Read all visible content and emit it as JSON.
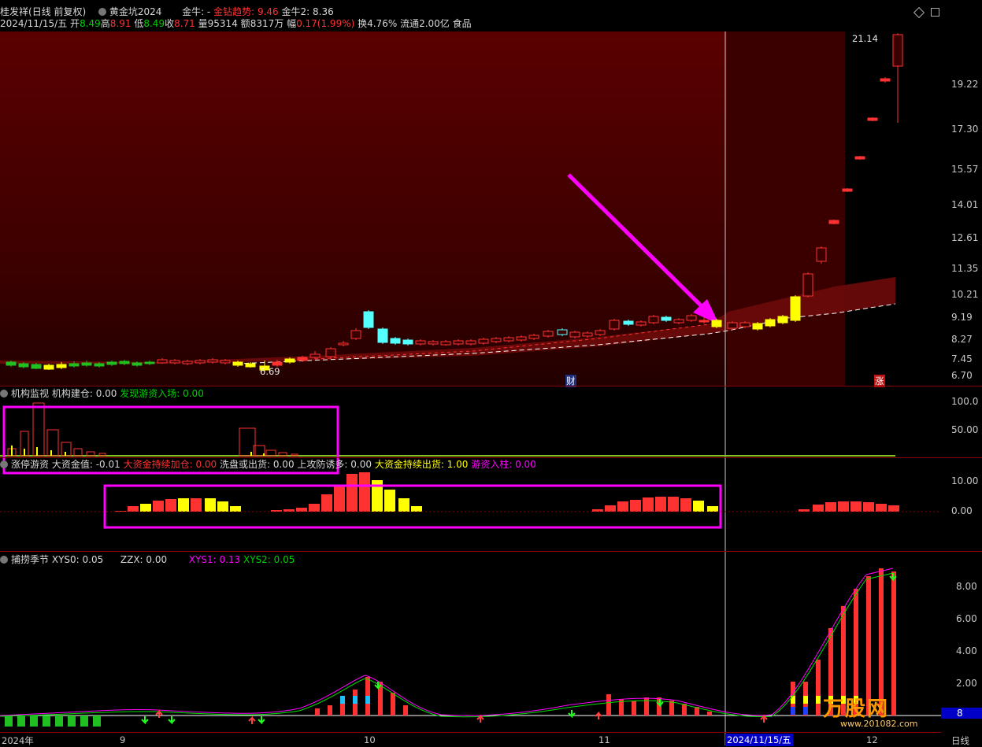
{
  "topbar": {
    "stock_name": "桂发祥",
    "period": "(日线 前复权)",
    "formula": "黄金坑2024",
    "jinniu_label": "金牛: -",
    "jinzuan_label": "金钻趋势: 9.46",
    "jinniu2_label": "金牛2: 8.36"
  },
  "quote": {
    "date": "2024/11/15/五",
    "open_label": "开",
    "open": "8.49",
    "high_label": "高",
    "high": "8.91",
    "low_label": "低",
    "low": "8.49",
    "close_label": "收",
    "close": "8.71",
    "vol_label": "量",
    "vol": "95314",
    "amt_label": "额",
    "amt": "8317万",
    "chg_label": "幅",
    "chg": "0.17(1.99%)",
    "turn": "换4.76%",
    "float": "流通2.00亿",
    "industry": "食品"
  },
  "main_axis": [
    "21.14",
    "19.22",
    "17.30",
    "15.57",
    "14.01",
    "12.61",
    "11.35",
    "10.21",
    "9.19",
    "8.27",
    "7.45",
    "6.70"
  ],
  "main_marks": {
    "high_tag": "21.14",
    "low_tag": "6.69",
    "cai": "财",
    "zhang": "涨"
  },
  "panel1": {
    "title": "机构监视",
    "l1": "机构建仓: 0.00",
    "l2": "发现游资入场: 0.00",
    "axis": [
      "100.0",
      "50.00"
    ]
  },
  "panel2": {
    "title": "涨停游资",
    "l1": "大资金值: -0.01",
    "l2": "大资金持续加仓: 0.00",
    "l3": "洗盘或出货: 0.00",
    "l4": "上攻防诱多: 0.00",
    "l5": "大资金持续出货: 1.00",
    "l6": "游资入柱: 0.00",
    "axis": [
      "10.00",
      "0.00"
    ]
  },
  "panel3": {
    "title": "捕捞季节",
    "l1": "XYS0: 0.05",
    "l2": "ZZX: 0.00",
    "l3": "XYS1: 0.13",
    "l4": "XYS2: 0.05",
    "axis": [
      "8.00",
      "6.00",
      "4.00",
      "2.00"
    ],
    "last_value": "8"
  },
  "xaxis": {
    "labels": [
      "2024年",
      "9",
      "10",
      "11",
      "12"
    ],
    "cursor_date": "2024/11/15/五",
    "period_label": "日线"
  },
  "watermark": {
    "site": "www.201082.com",
    "brand": "万股网"
  },
  "colors": {
    "up": "#ff3232",
    "down": "#54ffff",
    "yellow": "#ffff00",
    "magenta": "#ff00ff",
    "green": "#00c000",
    "grid": "#8b0000"
  }
}
